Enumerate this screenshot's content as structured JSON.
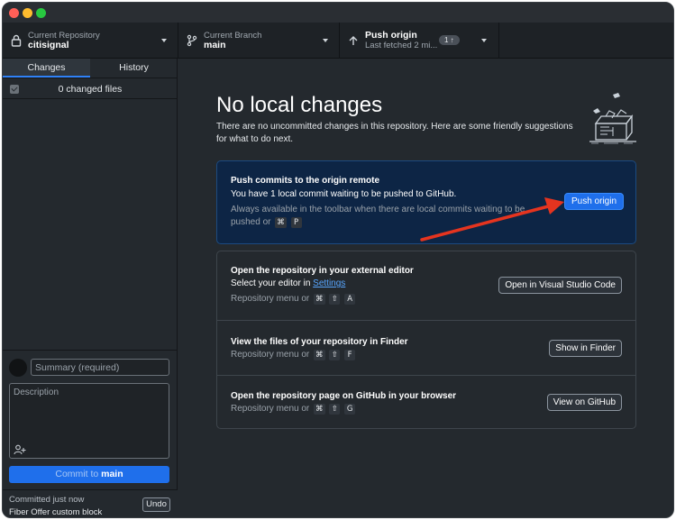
{
  "toolbar": {
    "repository": {
      "label": "Current Repository",
      "value": "citisignal"
    },
    "branch": {
      "label": "Current Branch",
      "value": "main"
    },
    "push": {
      "title": "Push origin",
      "subtitle": "Last fetched 2 mi...",
      "badge": "1 ↑"
    }
  },
  "sidebar": {
    "tabs": [
      {
        "label": "Changes"
      },
      {
        "label": "History"
      }
    ],
    "changed_files": "0 changed files",
    "summary_placeholder": "Summary (required)",
    "description_placeholder": "Description",
    "commit_prefix": "Commit to ",
    "commit_branch": "main",
    "last_commit": {
      "time": "Committed just now",
      "message": "Fiber Offer custom block",
      "undo_label": "Undo"
    }
  },
  "main": {
    "heading": "No local changes",
    "subtitle": "There are no uncommitted changes in this repository. Here are some friendly suggestions for what to do next.",
    "push_card": {
      "title": "Push commits to the origin remote",
      "description": "You have 1 local commit waiting to be pushed to GitHub.",
      "hint": "Always available in the toolbar when there are local commits waiting to be pushed or",
      "shortcut": [
        "⌘",
        "P"
      ],
      "button_label": "Push origin"
    },
    "suggestions": [
      {
        "title": "Open the repository in your external editor",
        "line_prefix": "Select your editor in ",
        "link": "Settings",
        "hint": "Repository menu or",
        "shortcut": [
          "⌘",
          "⇧",
          "A"
        ],
        "button_label": "Open in Visual Studio Code"
      },
      {
        "title": "View the files of your repository in Finder",
        "hint": "Repository menu or",
        "shortcut": [
          "⌘",
          "⇧",
          "F"
        ],
        "button_label": "Show in Finder"
      },
      {
        "title": "Open the repository page on GitHub in your browser",
        "hint": "Repository menu or",
        "shortcut": [
          "⌘",
          "⇧",
          "G"
        ],
        "button_label": "View on GitHub"
      }
    ]
  },
  "colors": {
    "accent": "#1f6feb",
    "annotation_arrow": "#e5341f",
    "close": "#ff5f57",
    "minimize": "#febc2e",
    "zoom": "#28c840"
  },
  "icons": [
    "lock-icon",
    "branch-icon",
    "push-arrow-icon",
    "chevron-down-icon",
    "add-coauthor-icon",
    "illustration"
  ]
}
